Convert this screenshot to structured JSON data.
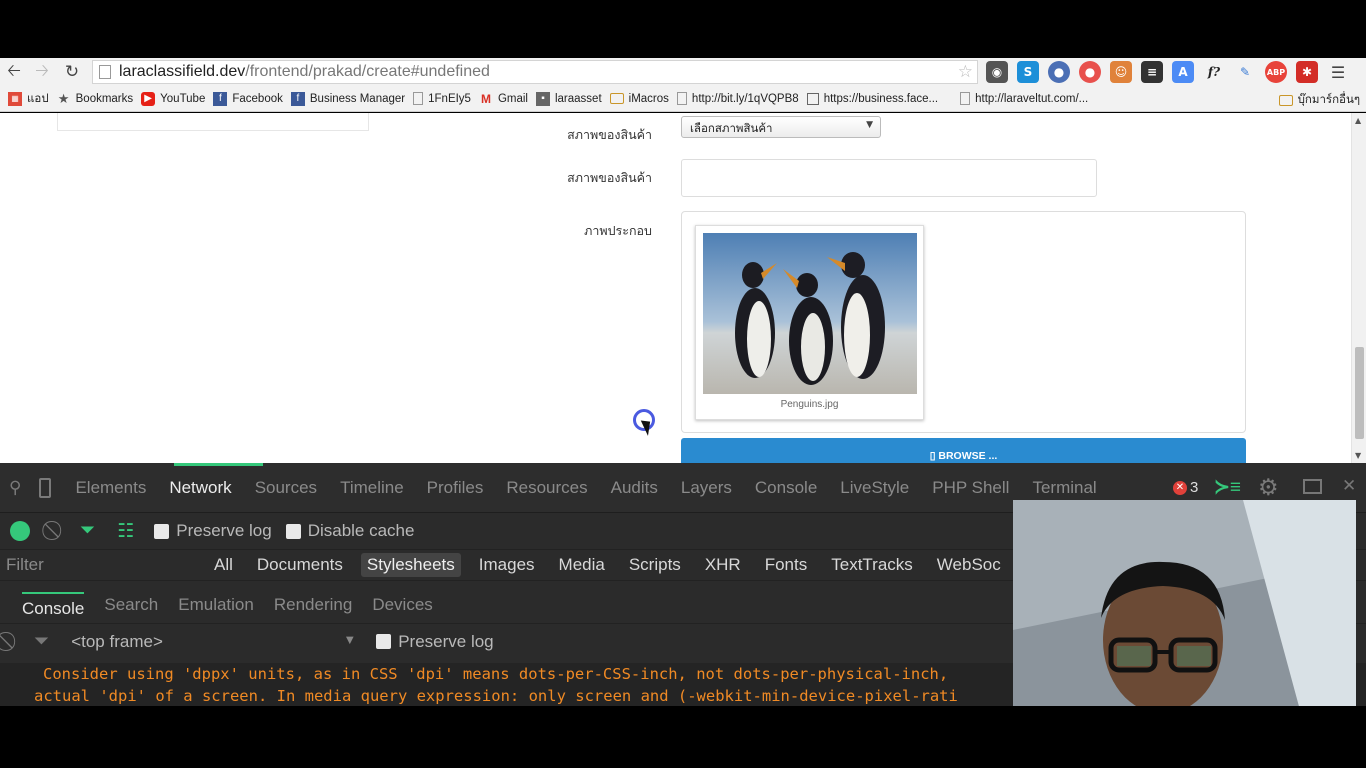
{
  "browser": {
    "url_host": "laraclassifield.dev",
    "url_path": "/frontend/prakad/create#undefined",
    "bookmarks": [
      {
        "label": "แอป",
        "icon": "apps-grid-icon",
        "color": "#e04a3a"
      },
      {
        "label": "Bookmarks",
        "icon": "star-icon",
        "color": "#555555"
      },
      {
        "label": "YouTube",
        "icon": "youtube-icon",
        "color": "#e62117"
      },
      {
        "label": "Facebook",
        "icon": "facebook-icon",
        "color": "#3b5998"
      },
      {
        "label": "Business Manager",
        "icon": "facebook-icon",
        "color": "#3b5998"
      },
      {
        "label": "1FnEIy5",
        "icon": "page-icon",
        "color": "#999999"
      },
      {
        "label": "Gmail",
        "icon": "gmail-icon",
        "color": "#d93025"
      },
      {
        "label": "laraasset",
        "icon": "bookmark-icon",
        "color": "#666666"
      },
      {
        "label": "iMacros",
        "icon": "folder-icon",
        "color": "#e8b64b"
      },
      {
        "label": "http://bit.ly/1qVQPB8",
        "icon": "page-icon",
        "color": "#999999"
      },
      {
        "label": "https://business.face...",
        "icon": "calendar-icon",
        "color": "#666666"
      },
      {
        "label": "http://laraveltut.com/...",
        "icon": "page-icon",
        "color": "#999999"
      }
    ],
    "other_bookmarks": "บุ๊กมาร์กอื่นๆ"
  },
  "form": {
    "condition_label": "สภาพของสินค้า",
    "condition_select": "เลือกสภาพสินค้า",
    "condition2_label": "สภาพของสินค้า",
    "image_label": "ภาพประกอบ",
    "image_caption": "Penguins.jpg",
    "browse_button": "▯ BROWSE ..."
  },
  "devtools": {
    "tabs": [
      "Elements",
      "Network",
      "Sources",
      "Timeline",
      "Profiles",
      "Resources",
      "Audits",
      "Layers",
      "Console",
      "LiveStyle",
      "PHP Shell",
      "Terminal"
    ],
    "active_tab": "Network",
    "error_count": "3",
    "preserve_log": "Preserve log",
    "disable_cache": "Disable cache",
    "filter_placeholder": "Filter",
    "type_filters": [
      "All",
      "Documents",
      "Stylesheets",
      "Images",
      "Media",
      "Scripts",
      "XHR",
      "Fonts",
      "TextTracks",
      "WebSoc"
    ],
    "active_type": "Stylesheets",
    "drawer_tabs": [
      "Console",
      "Search",
      "Emulation",
      "Rendering",
      "Devices"
    ],
    "frame_select": "<top frame>",
    "console_preserve_log": "Preserve log",
    "console_line1": "Consider using 'dppx' units, as in CSS 'dpi' means dots-per-CSS-inch, not dots-per-physical-inch,",
    "console_line2": "actual 'dpi' of a screen. In media query expression: only screen and (-webkit-min-device-pixel-rati",
    "accent_color": "#35c87b",
    "warning_color": "#f08a24"
  }
}
